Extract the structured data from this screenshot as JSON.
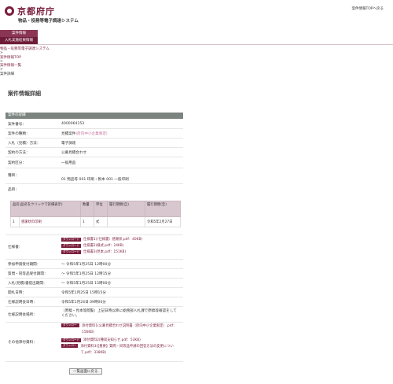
{
  "header": {
    "logo_text": "京都府庁",
    "system_name": "物品・役務等電子調達システム",
    "top_link": "案件情報TOPへ戻る"
  },
  "nav": {
    "items": [
      {
        "label": "案件情報"
      },
      {
        "label": "入札実施結果情報"
      }
    ]
  },
  "breadcrumb": {
    "items": [
      {
        "label": "物品・役務等電子調達システム"
      },
      {
        "label": "案件情報TOP"
      },
      {
        "label": "案件情報一覧"
      },
      {
        "label": "案件詳細"
      }
    ],
    "separator": ">"
  },
  "page_title": "案件情報詳細",
  "panel": {
    "title": "案件の詳細",
    "fields": {
      "case_number_label": "案件番号：",
      "case_number": "4000064153",
      "case_type_label": "案件の種類：",
      "case_type": "見積案件",
      "case_type_note": "(府内中小企業限定)",
      "bid_method_label": "入札（見積）方法：",
      "bid_method": "電子調達",
      "contract_method_label": "契約の方法：",
      "contract_method": "公募見積合わせ",
      "contract_category_label": "契約区分：",
      "contract_category": "一般用品",
      "type_label": "種目：",
      "type_value": "01  物品等  001  印刷・製本  001  一般印刷",
      "items_label": "品目："
    },
    "items_table": {
      "headers": [
        "品名(品名をクリックで詳細表示)",
        "数量",
        "単位",
        "履行期間(自)",
        "履行期間(至)"
      ],
      "rows": [
        {
          "no": "1",
          "name": "感謝状の印刷",
          "qty": "1",
          "unit": "式",
          "from": "",
          "to": "令和5年2月27日"
        }
      ]
    },
    "spec_label": "仕様書：",
    "download_badge": "ダウンロード",
    "spec_files": [
      {
        "label": "仕様書1(（仕様書）感謝状.pdf：40KB)"
      },
      {
        "label": "仕様書2(様式.pdf：24KB)"
      },
      {
        "label": "仕様書3(見本.pdf：151KB)"
      }
    ],
    "dates": {
      "apply_label": "参加申請受付期間：",
      "apply_value": "～ 令和5年1月25日 12時00分",
      "question_label": "質問・同等品受付期間：",
      "question_value": "～ 令和5年1月25日 12時15分",
      "bid_label": "入札(見積)書提出期間：",
      "bid_value": "～ 令和5年1月25日 15時00分",
      "open_label": "開札日時：",
      "open_value": "令和5年1月25日 15時15分",
      "spec_give_label": "仕様説明会日時：",
      "spec_give_value": "令和5年1月24日 09時00分",
      "spec_place_label": "仕様説明会場所：",
      "spec_place_value": "（原稿・見本等閲覧）上記日時以降に総務部入札課で原稿等確認をしてください。"
    },
    "other_label": "その他添付資料：",
    "other_files": [
      {
        "label": "添付資料1(公募見積合わせ説明書（府内中小企業限定）.pdf：156KB)"
      },
      {
        "label": "添付資料2(種収支知らせ.pdf：53KB)"
      },
      {
        "label": "添付資料3(【重要】質問・同等品申請の回答方法の変更について.pdf：338KB)"
      }
    ]
  },
  "back_button": "一覧画面に戻る",
  "colors": {
    "brand": "#7a1e3c",
    "nav_bg": "#8a3553",
    "panel_head": "#7c8480",
    "table_head": "#d9c7cf"
  }
}
